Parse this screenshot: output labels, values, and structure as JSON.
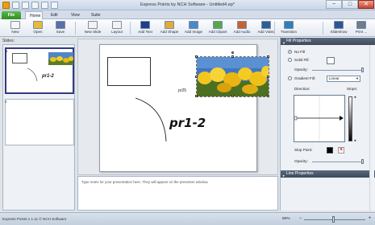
{
  "window": {
    "title": "Express Points by NCH Software - Untitled4.ep*",
    "controls": {
      "minimize": "−",
      "maximize": "□",
      "close": "✕"
    }
  },
  "tabs": [
    "File",
    "Home",
    "Edit",
    "View",
    "Suite"
  ],
  "ribbon": {
    "buttons": [
      {
        "label": "New",
        "icon": "new-document-icon",
        "color": "#f6f6f6"
      },
      {
        "label": "Open",
        "icon": "open-folder-icon",
        "color": "#e9b93d"
      },
      {
        "label": "Save",
        "icon": "save-disk-icon",
        "color": "#5b6fa8"
      },
      {
        "label": "New Slide",
        "icon": "new-slide-icon",
        "color": "#f2f2f2"
      },
      {
        "label": "Layout",
        "icon": "layout-icon",
        "color": "#f2f2f2"
      },
      {
        "label": "Add Text",
        "icon": "text-icon",
        "color": "#1f3e8c"
      },
      {
        "label": "Add Shape",
        "icon": "shape-icon",
        "color": "#e2a93b"
      },
      {
        "label": "Add Image",
        "icon": "image-icon",
        "color": "#4a8ac9"
      },
      {
        "label": "Add Clipart",
        "icon": "clipart-icon",
        "color": "#57a84c"
      },
      {
        "label": "Add Audio",
        "icon": "audio-icon",
        "color": "#c6642f"
      },
      {
        "label": "Add Video",
        "icon": "video-icon",
        "color": "#2d5e9c"
      },
      {
        "label": "Transition",
        "icon": "transition-icon",
        "color": "#2f7fbd"
      },
      {
        "label": "Slideshow",
        "icon": "slideshow-icon",
        "color": "#2b5893"
      },
      {
        "label": "Print ...",
        "icon": "print-icon",
        "color": "#6d7c8e"
      }
    ]
  },
  "slides_panel": {
    "label": "Slides:",
    "slides": [
      {
        "number": "1",
        "text": "pr1-2"
      },
      {
        "number": "2"
      }
    ]
  },
  "slide": {
    "text_small": "pr25",
    "text_large": "pr1-2"
  },
  "notes": {
    "placeholder": "Type notes for your presentation here. They will appear on the presenter window."
  },
  "fill_properties": {
    "header": "Fill Properties",
    "no_fill": "No Fill",
    "solid_fill": "Solid Fill:",
    "opacity_label": "Opacity:",
    "gradient_fill": "Gradient Fill:",
    "gradient_type": "Linear",
    "direction_label": "Direction:",
    "stops_label": "Stops:",
    "stop_point_label": "Stop Point:",
    "stop_opacity_label": "Opacity:",
    "selected": "No Fill"
  },
  "line_properties": {
    "header": "Line Properties"
  },
  "statusbar": {
    "text": "Express Points v 1.11 © NCH Software",
    "zoom": "50%",
    "zoom_minus": "−",
    "zoom_plus": "+"
  }
}
